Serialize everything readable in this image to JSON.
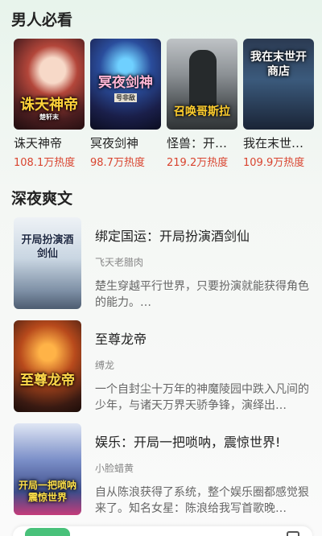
{
  "sections": {
    "top_title": "男人必看",
    "list_title": "深夜爽文"
  },
  "top_books": [
    {
      "title": "诛天神帝",
      "heat": "108.1万热度",
      "cover_text": "诛天神帝",
      "cover_sub": "楚轩末"
    },
    {
      "title": "冥夜剑神",
      "heat": "98.7万热度",
      "cover_text": "冥夜剑神",
      "cover_sub": "号非敌"
    },
    {
      "title": "怪兽：开…",
      "heat": "219.2万热度",
      "cover_text": "召唤哥斯拉",
      "cover_sub": ""
    },
    {
      "title": "我在末世…",
      "heat": "109.9万热度",
      "cover_text": "我在末世开商店",
      "cover_sub": ""
    }
  ],
  "list_books": [
    {
      "title": "绑定国运：开局扮演酒剑仙",
      "author": "飞天老腊肉",
      "desc": "楚生穿越平行世界，只要扮演就能获得角色的能力。…",
      "cover_text": "开局扮演酒剑仙"
    },
    {
      "title": "至尊龙帝",
      "author": "缚龙",
      "desc": "一个自封尘十万年的神魔陵园中跌入凡间的少年，与诸天万界天骄争锋，演绎出…",
      "cover_text": "至尊龙帝"
    },
    {
      "title": "娱乐：开局一把唢呐，震惊世界!",
      "author": "小脸蜡黄",
      "desc": "自从陈浪获得了系统，整个娱乐圈都感觉狠来了。知名女星：陈浪给我写首歌晚…",
      "cover_text": "开局一把唢呐震惊世界"
    }
  ],
  "colors": {
    "heat": "#d9442f",
    "accent": "#49c17a"
  }
}
